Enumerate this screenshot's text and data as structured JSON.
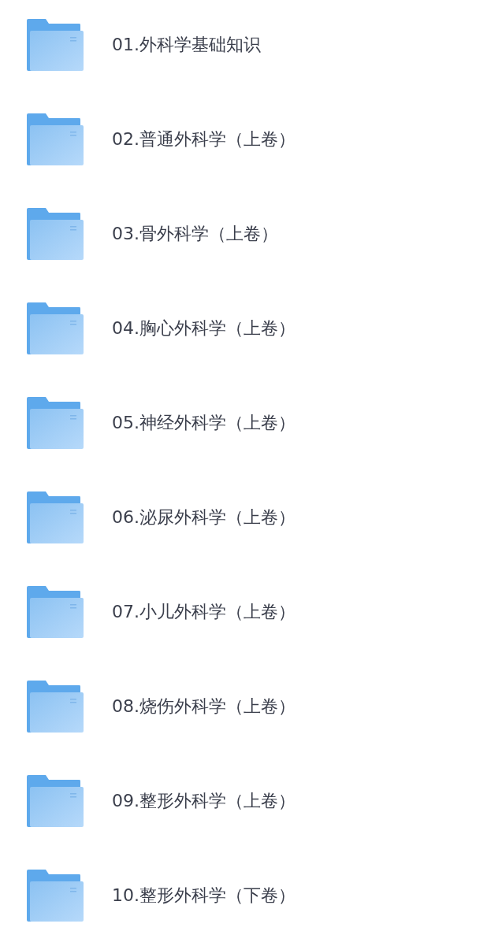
{
  "folders": [
    {
      "name": "01.外科学基础知识"
    },
    {
      "name": "02.普通外科学（上卷）"
    },
    {
      "name": "03.骨外科学（上卷）"
    },
    {
      "name": "04.胸心外科学（上卷）"
    },
    {
      "name": "05.神经外科学（上卷）"
    },
    {
      "name": "06.泌尿外科学（上卷）"
    },
    {
      "name": "07.小儿外科学（上卷）"
    },
    {
      "name": "08.烧伤外科学（上卷）"
    },
    {
      "name": "09.整形外科学（上卷）"
    },
    {
      "name": "10.整形外科学（下卷）"
    }
  ]
}
